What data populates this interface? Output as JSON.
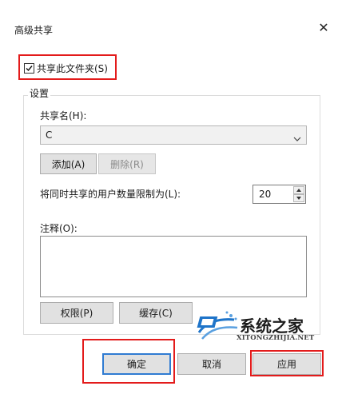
{
  "window": {
    "title": "高级共享",
    "close_glyph": "✕"
  },
  "share_checkbox": {
    "label": "共享此文件夹(S)",
    "checked": true
  },
  "settings": {
    "legend": "设置",
    "share_name_label": "共享名(H):",
    "share_name_value": "C",
    "add_button": "添加(A)",
    "remove_button": "删除(R)",
    "user_limit_label": "将同时共享的用户数量限制为(L):",
    "user_limit_value": "20",
    "comments_label": "注释(O):",
    "comments_value": "",
    "permissions_button": "权限(P)",
    "caching_button": "缓存(C)"
  },
  "footer": {
    "ok_button": "确定",
    "cancel_button": "取消",
    "apply_button": "应用"
  },
  "watermark": {
    "name": "系统之家",
    "url": "XITONGZHIJIA.NET"
  },
  "colors": {
    "highlight": "#e31b1b",
    "primary_border": "#2f7bd2",
    "logo_blue": "#1e74c9"
  }
}
